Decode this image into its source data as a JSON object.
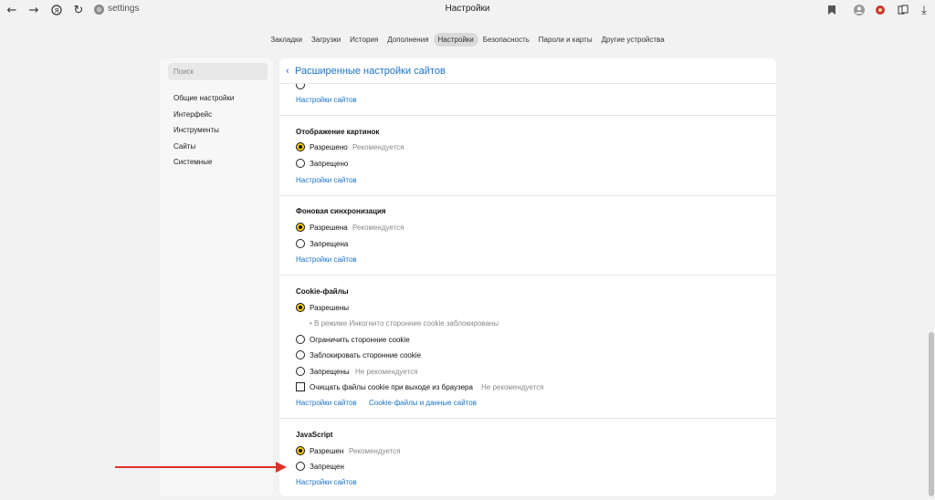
{
  "browser": {
    "url": "settings",
    "window_title": "Настройки"
  },
  "tabs": [
    {
      "label": "Закладки",
      "active": false
    },
    {
      "label": "Загрузки",
      "active": false
    },
    {
      "label": "История",
      "active": false
    },
    {
      "label": "Дополнения",
      "active": false
    },
    {
      "label": "Настройки",
      "active": true
    },
    {
      "label": "Безопасность",
      "active": false
    },
    {
      "label": "Пароли и карты",
      "active": false
    },
    {
      "label": "Другие устройства",
      "active": false
    }
  ],
  "sidebar": {
    "search_placeholder": "Поиск",
    "items": [
      "Общие настройки",
      "Интерфейс",
      "Инструменты",
      "Сайты",
      "Системные"
    ]
  },
  "main": {
    "back_title": "Расширенные настройки сайтов",
    "top_link": "Настройки сайтов",
    "images": {
      "title": "Отображение картинок",
      "opt_allowed": "Разрешено",
      "opt_allowed_hint": "Рекомендуется",
      "opt_denied": "Запрещено",
      "link": "Настройки сайтов"
    },
    "bg_sync": {
      "title": "Фоновая синхронизация",
      "opt_allowed": "Разрешена",
      "opt_allowed_hint": "Рекомендуется",
      "opt_denied": "Запрещена",
      "link": "Настройки сайтов"
    },
    "cookies": {
      "title": "Cookie-файлы",
      "opt_allowed": "Разрешены",
      "incognito_note": "• В режиме Инкогнито сторонние cookie заблокированы",
      "opt_limit": "Ограничить сторонние cookie",
      "opt_block": "Заблокировать сторонние cookie",
      "opt_denied": "Запрещены",
      "opt_denied_hint": "Не рекомендуется",
      "clear_on_exit": "Очищать файлы cookie при выходе из браузера",
      "clear_on_exit_hint": "Не рекомендуется",
      "link1": "Настройки сайтов",
      "link2": "Cookie-файлы и данные сайтов"
    },
    "javascript": {
      "title": "JavaScript",
      "opt_allowed": "Разрешен",
      "opt_allowed_hint": "Рекомендуется",
      "opt_denied": "Запрещен",
      "link": "Настройки сайтов"
    }
  },
  "colors": {
    "accent_link": "#1a73c8",
    "radio_selected": "#ffcc00",
    "annotation_arrow": "#e0302a"
  }
}
